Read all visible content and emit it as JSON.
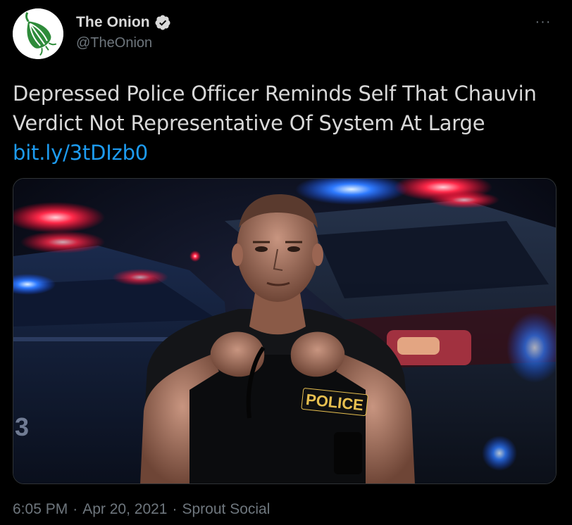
{
  "author": {
    "display_name": "The Onion",
    "handle": "@TheOnion",
    "verified": true,
    "avatar_icon": "onion-logo-icon"
  },
  "tweet": {
    "text": "Depressed Police Officer Reminds Self That Chauvin Verdict Not Representative Of System At Large ",
    "link": "bit.ly/3tDIzb0"
  },
  "media": {
    "badge_text": "POLICE",
    "car_number": "3"
  },
  "meta": {
    "time": "6:05 PM",
    "date": "Apr 20, 2021",
    "source": "Sprout Social",
    "separator": "·"
  },
  "more_label": "···",
  "colors": {
    "background": "#000000",
    "text": "#d9d9d9",
    "secondary": "#6e767d",
    "link": "#1d9bf0",
    "verified": "#d9d9d9",
    "onion_green": "#2e8b3a"
  }
}
